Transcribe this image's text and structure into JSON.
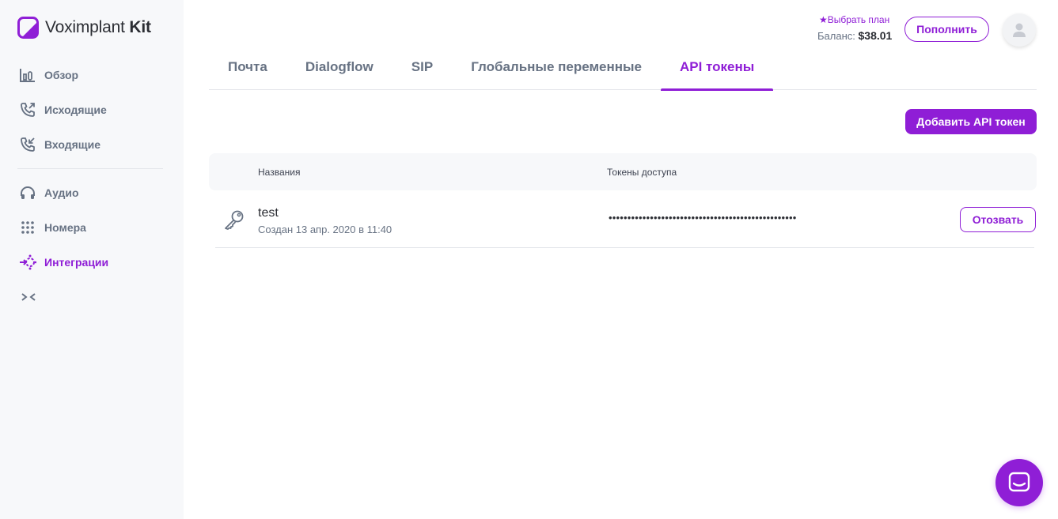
{
  "app": {
    "logo_name": "Voximplant",
    "logo_suffix": "Kit"
  },
  "sidebar": {
    "items": [
      {
        "label": "Обзор",
        "icon": "overview-chart-icon"
      },
      {
        "label": "Исходящие",
        "icon": "outgoing-call-icon"
      },
      {
        "label": "Входящие",
        "icon": "incoming-call-icon"
      },
      {
        "label": "Аудио",
        "icon": "headphones-icon"
      },
      {
        "label": "Номера",
        "icon": "dialpad-icon"
      },
      {
        "label": "Интеграции",
        "icon": "integrations-icon",
        "active": true
      }
    ],
    "collapse_icon": "collapse-arrows-icon"
  },
  "header": {
    "plan_label": "★Выбрать план",
    "balance_label": "Баланс:",
    "balance_value": "$38.01",
    "topup_label": "Пополнить",
    "avatar_icon": "user-icon"
  },
  "tabs": [
    {
      "label": "Почта"
    },
    {
      "label": "Dialogflow"
    },
    {
      "label": "SIP"
    },
    {
      "label": "Глобальные переменные"
    },
    {
      "label": "API токены",
      "active": true
    }
  ],
  "actions": {
    "add_token_label": "Добавить API токен"
  },
  "table": {
    "headers": {
      "name": "Названия",
      "token": "Токены доступа"
    },
    "rows": [
      {
        "name": "test",
        "created": "Создан 13 апр. 2020 в 11:40",
        "token": "••••••••••••••••••••••••••••••••••••••••••••••••••",
        "revoke_label": "Отозвать",
        "icon": "key-icon"
      }
    ]
  },
  "colors": {
    "accent": "#8f1ed6",
    "sidebar_bg": "#f7f8fa",
    "muted_text": "#677283",
    "divider": "#e3e5ea"
  },
  "chat_icon": "chat-widget-icon"
}
